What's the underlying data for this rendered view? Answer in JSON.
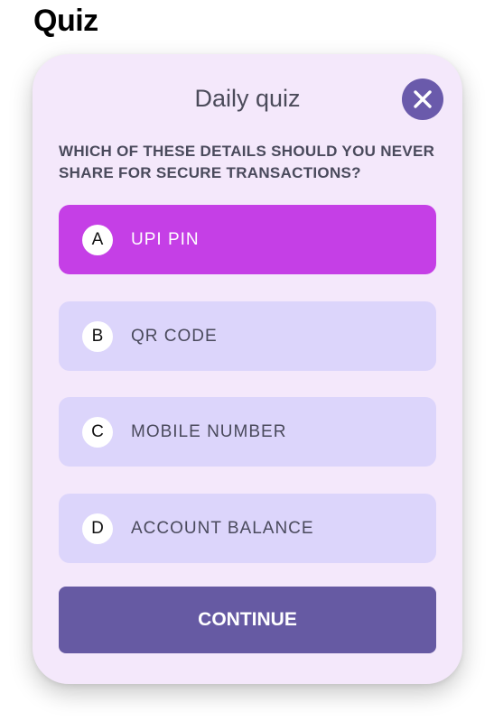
{
  "page": {
    "title": "Quiz"
  },
  "quiz": {
    "title": "Daily quiz",
    "close_icon": "close-icon",
    "question": "WHICH OF THESE DETAILS SHOULD YOU NEVER SHARE FOR SECURE TRANSACTIONS?",
    "options": [
      {
        "letter": "A",
        "label": "UPI PIN",
        "selected": true
      },
      {
        "letter": "B",
        "label": "QR CODE",
        "selected": false
      },
      {
        "letter": "C",
        "label": "MOBILE NUMBER",
        "selected": false
      },
      {
        "letter": "D",
        "label": "ACCOUNT BALANCE",
        "selected": false
      }
    ],
    "continue_label": "CONTINUE"
  },
  "colors": {
    "card_background": "#f4e8fb",
    "option_default": "#dcd5fb",
    "option_selected": "#c53fe6",
    "primary": "#665aa3",
    "text": "#4a4a5c"
  }
}
